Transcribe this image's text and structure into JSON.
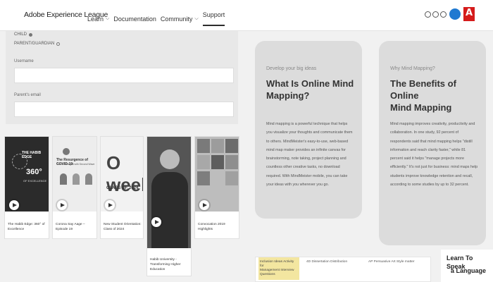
{
  "header": {
    "brand": "Adobe Experience League",
    "nav": [
      "Learn",
      "Documentation",
      "Community",
      "Support"
    ]
  },
  "form": {
    "child_label": "CHILD",
    "parent_label": "PARENT/GUARDIAN",
    "username_label": "Username",
    "parent_email_label": "Parent's email"
  },
  "videos": [
    {
      "caption": "The Habib Edge: 360° of Excellence",
      "thumb_title": "THE HABIB EDGE",
      "thumb_sub": "360°",
      "thumb_sub2": "OF EXCELLENCE"
    },
    {
      "caption": "Corona Say Aage – Episode 19",
      "thumb_title": "The Resurgence of COVID-19:",
      "thumb_sub": "The Challenges with Second Wave"
    },
    {
      "caption": "New Student Orientation: Class of 2024",
      "thumb_title": "O week",
      "thumb_sub": "CLASS OF 2024"
    },
    {
      "caption": "Habib University - Transforming Higher Education",
      "thumb_title": "",
      "thumb_sub": ""
    },
    {
      "caption": "Convocation 2019 Highlights",
      "thumb_title": "",
      "thumb_sub": ""
    }
  ],
  "info_cards": [
    {
      "eyebrow": "Develop your big ideas",
      "title_lines": [
        "What Is Online Mind",
        "Mapping?"
      ],
      "body_lines": [
        "Mind mapping is a powerful technique that helps",
        "you visualize your thoughts and communicate them",
        "to others. MindMeister's easy-to-use, web-based",
        "mind map maker provides an infinite canvas for",
        "brainstorming, note taking, project planning and",
        "countless other creative tasks, no download",
        "required. With MindMeister mobile, you can take",
        "your ideas with you wherever you go."
      ]
    },
    {
      "eyebrow": "Why Mind Mapping?",
      "title_lines": [
        "The Benefits of Online",
        "Mind Mapping"
      ],
      "body_lines": [
        "Mind mapping improves creativity, productivity and",
        "collaboration. In one study, 92 percent of",
        "respondents said that mind mapping helps \"distill",
        "information and reach clarity faster,\" while 81",
        "percent said it helps \"manage projects more",
        "efficiently.\" It's not just for business: mind maps help",
        "students improve knowledge retention and recall,",
        "according to some studies by up to 32 percent."
      ]
    }
  ],
  "strip": {
    "cell1": [
      "Inclusion Ideas Activity for",
      "Management Interview",
      "Questions"
    ],
    "cell2": "4D Dissertation Distribution",
    "cell3": "AP Persuasive Art Style matter"
  },
  "promo": [
    "Learn To Speak",
    "a Language"
  ]
}
